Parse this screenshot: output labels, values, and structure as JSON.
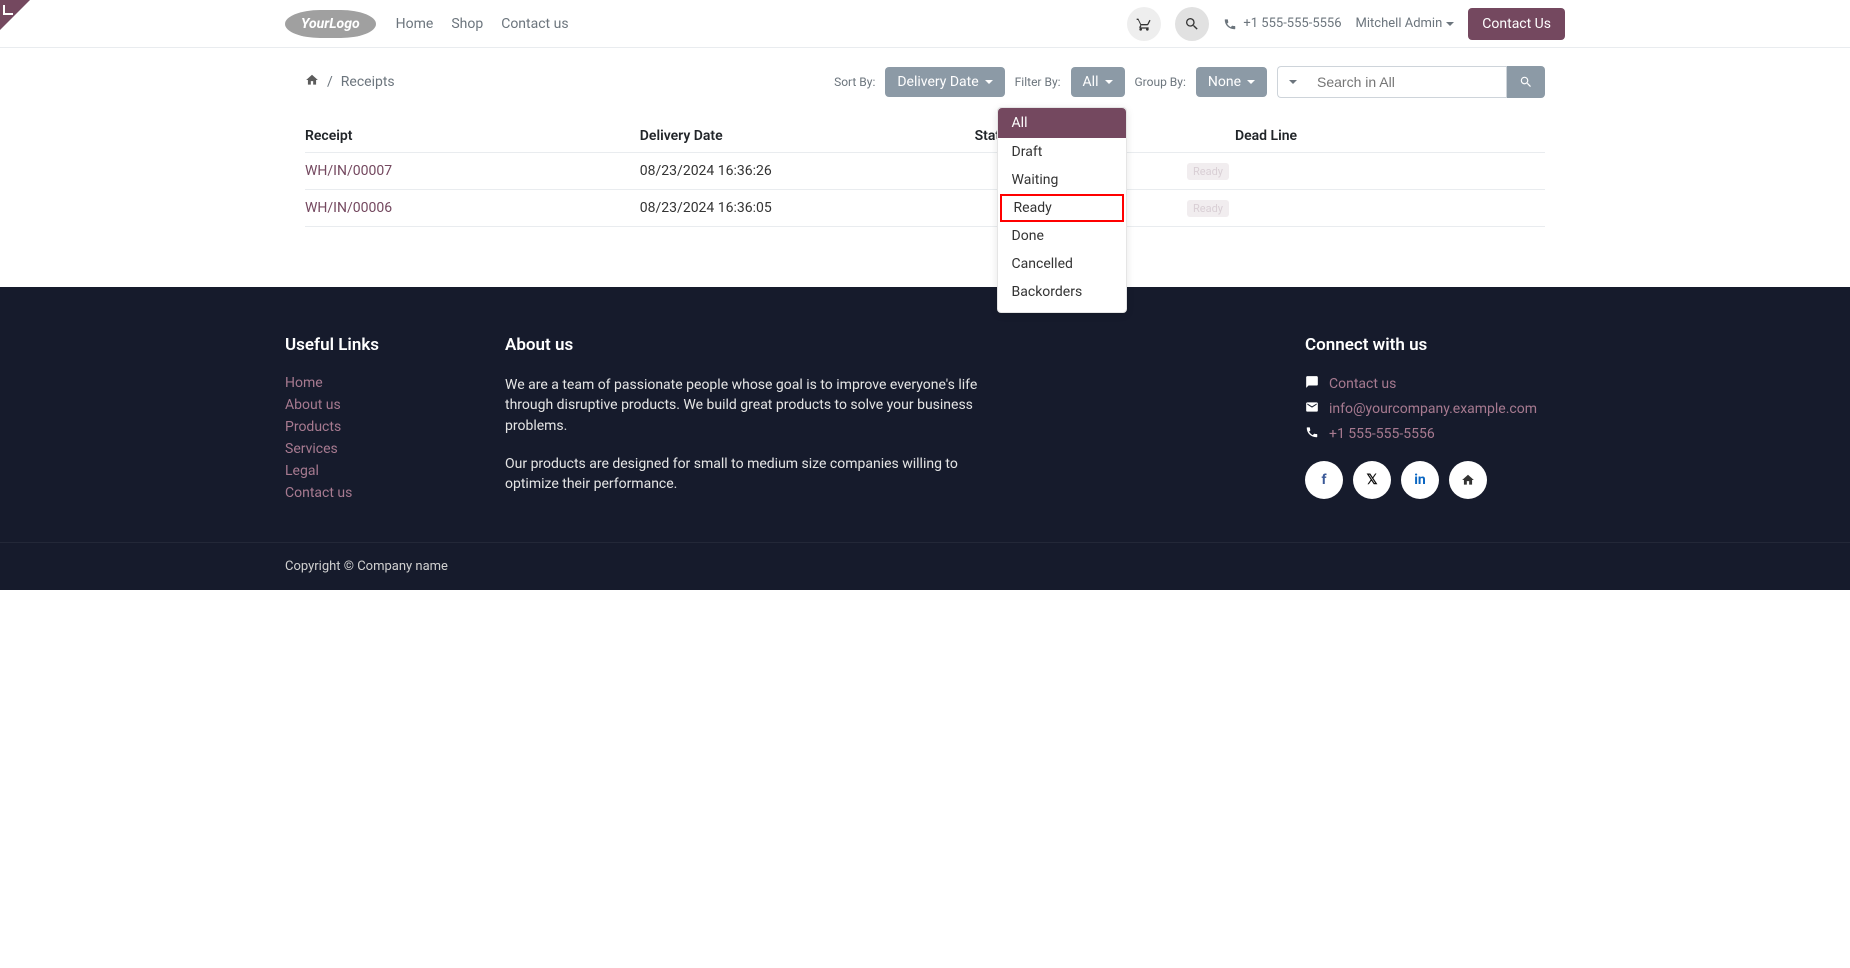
{
  "header": {
    "logo_text": "YourLogo",
    "nav": [
      "Home",
      "Shop",
      "Contact us"
    ],
    "phone": "+1 555-555-5556",
    "user": "Mitchell Admin",
    "contact_btn": "Contact Us"
  },
  "breadcrumb": {
    "current": "Receipts"
  },
  "toolbar": {
    "sort_label": "Sort By:",
    "sort_value": "Delivery Date",
    "filter_label": "Filter By:",
    "filter_value": "All",
    "group_label": "Group By:",
    "group_value": "None",
    "search_placeholder": "Search in All"
  },
  "filter_options": [
    "All",
    "Draft",
    "Waiting",
    "Ready",
    "Done",
    "Cancelled",
    "Backorders"
  ],
  "filter_active": "All",
  "filter_highlighted": "Ready",
  "table": {
    "headers": [
      "Receipt",
      "Delivery Date",
      "State",
      "Dead Line"
    ],
    "rows": [
      {
        "receipt": "WH/IN/00007",
        "date": "08/23/2024  16:36:26",
        "state": "Ready",
        "deadline": ""
      },
      {
        "receipt": "WH/IN/00006",
        "date": "08/23/2024  16:36:05",
        "state": "Ready",
        "deadline": ""
      }
    ]
  },
  "footer": {
    "useful_title": "Useful Links",
    "useful_links": [
      "Home",
      "About us",
      "Products",
      "Services",
      "Legal",
      "Contact us"
    ],
    "about_title": "About us",
    "about_p1": "We are a team of passionate people whose goal is to improve everyone's life through disruptive products. We build great products to solve your business problems.",
    "about_p2": "Our products are designed for small to medium size companies willing to optimize their performance.",
    "connect_title": "Connect with us",
    "connect_contact": "Contact us",
    "connect_email": "info@yourcompany.example.com",
    "connect_phone": "+1 555-555-5556",
    "copyright": "Copyright © Company name"
  }
}
